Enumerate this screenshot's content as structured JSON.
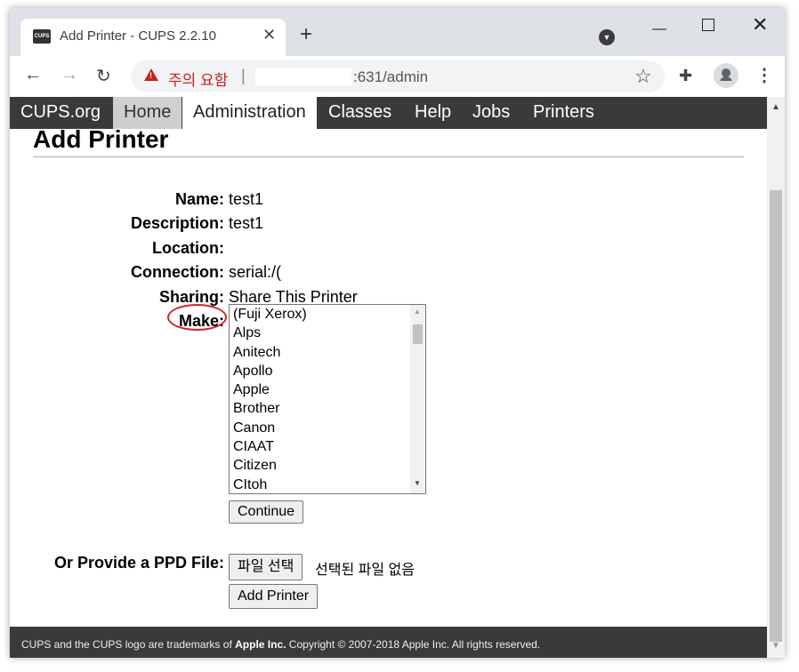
{
  "browser": {
    "tab_title": "Add Printer - CUPS 2.2.10",
    "favicon_text": "CUPS",
    "security_warning": "주의 요함",
    "url_separator": "|",
    "url": ":631/admin"
  },
  "nav": {
    "items": [
      "CUPS.org",
      "Home",
      "Administration",
      "Classes",
      "Help",
      "Jobs",
      "Printers"
    ],
    "active": "Administration"
  },
  "page": {
    "title": "Add Printer",
    "fields": {
      "name_label": "Name:",
      "name_value": "test1",
      "description_label": "Description:",
      "description_value": "test1",
      "location_label": "Location:",
      "location_value": "",
      "connection_label": "Connection:",
      "connection_value": "serial:/(",
      "sharing_label": "Sharing:",
      "sharing_value": "Share This Printer",
      "make_label": "Make:"
    },
    "make_options": [
      "(Fuji Xerox)",
      "Alps",
      "Anitech",
      "Apollo",
      "Apple",
      "Brother",
      "Canon",
      "CIAAT",
      "Citizen",
      "CItoh"
    ],
    "continue_label": "Continue",
    "ppd_label": "Or Provide a PPD File:",
    "file_button_label": "파일 선택",
    "no_file_text": "선택된 파일 없음",
    "add_printer_label": "Add Printer"
  },
  "footer": {
    "prefix": "CUPS and the CUPS logo are trademarks of ",
    "company": "Apple Inc.",
    "suffix": " Copyright © 2007-2018 Apple Inc. All rights reserved."
  },
  "colors": {
    "nav_bg": "#3a3a3a",
    "make_circle": "#d3222a",
    "warning": "#c5221f"
  }
}
